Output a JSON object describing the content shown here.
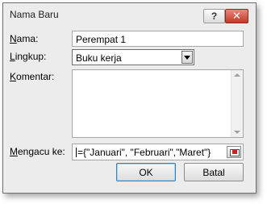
{
  "window": {
    "title": "Nama Baru",
    "help_label": "?",
    "close_label": "✕"
  },
  "form": {
    "name": {
      "label_first": "N",
      "label_rest": "ama:",
      "value": "Perempat 1"
    },
    "scope": {
      "label_first": "L",
      "label_rest": "ingkup:",
      "value": "Buku kerja"
    },
    "comment": {
      "label_first": "K",
      "label_rest": "omentar:",
      "value": ""
    },
    "refers_to": {
      "label_first": "M",
      "label_rest": "engacu ke:",
      "value": "={\"Januari\", \"Februari\",\"Maret\"}"
    }
  },
  "buttons": {
    "ok_label": "OK",
    "cancel_label": "Batal"
  },
  "icons": {
    "help": "help-icon",
    "close": "close-icon",
    "dropdown": "chevron-down-icon",
    "range_picker": "collapse-dialog-icon"
  }
}
